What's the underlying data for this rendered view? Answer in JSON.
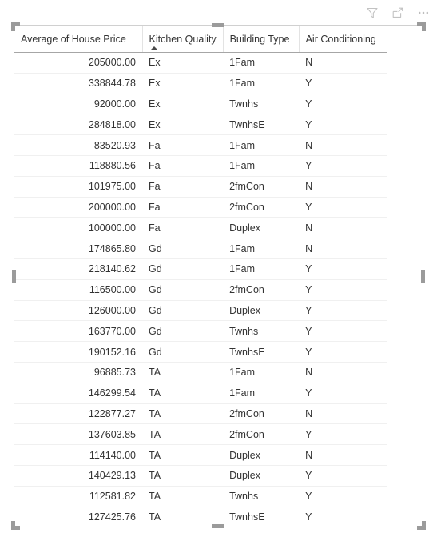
{
  "toolbar": {
    "icons": [
      {
        "name": "filter-icon",
        "label": "Filters"
      },
      {
        "name": "focus-mode-icon",
        "label": "Focus mode"
      },
      {
        "name": "more-options-icon",
        "label": "More options"
      }
    ]
  },
  "table": {
    "sorted_column": "Kitchen Quality",
    "sort_direction": "ascending",
    "columns": [
      {
        "key": "avg_price",
        "label": "Average of House Price",
        "align": "right"
      },
      {
        "key": "kitchen_quality",
        "label": "Kitchen Quality",
        "align": "left"
      },
      {
        "key": "building_type",
        "label": "Building Type",
        "align": "left"
      },
      {
        "key": "air_conditioning",
        "label": "Air Conditioning",
        "align": "left"
      }
    ],
    "rows": [
      {
        "avg_price": "205000.00",
        "kitchen_quality": "Ex",
        "building_type": "1Fam",
        "air_conditioning": "N"
      },
      {
        "avg_price": "338844.78",
        "kitchen_quality": "Ex",
        "building_type": "1Fam",
        "air_conditioning": "Y"
      },
      {
        "avg_price": "92000.00",
        "kitchen_quality": "Ex",
        "building_type": "Twnhs",
        "air_conditioning": "Y"
      },
      {
        "avg_price": "284818.00",
        "kitchen_quality": "Ex",
        "building_type": "TwnhsE",
        "air_conditioning": "Y"
      },
      {
        "avg_price": "83520.93",
        "kitchen_quality": "Fa",
        "building_type": "1Fam",
        "air_conditioning": "N"
      },
      {
        "avg_price": "118880.56",
        "kitchen_quality": "Fa",
        "building_type": "1Fam",
        "air_conditioning": "Y"
      },
      {
        "avg_price": "101975.00",
        "kitchen_quality": "Fa",
        "building_type": "2fmCon",
        "air_conditioning": "N"
      },
      {
        "avg_price": "200000.00",
        "kitchen_quality": "Fa",
        "building_type": "2fmCon",
        "air_conditioning": "Y"
      },
      {
        "avg_price": "100000.00",
        "kitchen_quality": "Fa",
        "building_type": "Duplex",
        "air_conditioning": "N"
      },
      {
        "avg_price": "174865.80",
        "kitchen_quality": "Gd",
        "building_type": "1Fam",
        "air_conditioning": "N"
      },
      {
        "avg_price": "218140.62",
        "kitchen_quality": "Gd",
        "building_type": "1Fam",
        "air_conditioning": "Y"
      },
      {
        "avg_price": "116500.00",
        "kitchen_quality": "Gd",
        "building_type": "2fmCon",
        "air_conditioning": "Y"
      },
      {
        "avg_price": "126000.00",
        "kitchen_quality": "Gd",
        "building_type": "Duplex",
        "air_conditioning": "Y"
      },
      {
        "avg_price": "163770.00",
        "kitchen_quality": "Gd",
        "building_type": "Twnhs",
        "air_conditioning": "Y"
      },
      {
        "avg_price": "190152.16",
        "kitchen_quality": "Gd",
        "building_type": "TwnhsE",
        "air_conditioning": "Y"
      },
      {
        "avg_price": "96885.73",
        "kitchen_quality": "TA",
        "building_type": "1Fam",
        "air_conditioning": "N"
      },
      {
        "avg_price": "146299.54",
        "kitchen_quality": "TA",
        "building_type": "1Fam",
        "air_conditioning": "Y"
      },
      {
        "avg_price": "122877.27",
        "kitchen_quality": "TA",
        "building_type": "2fmCon",
        "air_conditioning": "N"
      },
      {
        "avg_price": "137603.85",
        "kitchen_quality": "TA",
        "building_type": "2fmCon",
        "air_conditioning": "Y"
      },
      {
        "avg_price": "114140.00",
        "kitchen_quality": "TA",
        "building_type": "Duplex",
        "air_conditioning": "N"
      },
      {
        "avg_price": "140429.13",
        "kitchen_quality": "TA",
        "building_type": "Duplex",
        "air_conditioning": "Y"
      },
      {
        "avg_price": "112581.82",
        "kitchen_quality": "TA",
        "building_type": "Twnhs",
        "air_conditioning": "Y"
      },
      {
        "avg_price": "127425.76",
        "kitchen_quality": "TA",
        "building_type": "TwnhsE",
        "air_conditioning": "Y"
      }
    ]
  },
  "colors": {
    "text": "#333333",
    "header_rule": "#a6a6a6",
    "row_rule": "#f0f0f0",
    "grid": "#e3e3e3",
    "frame_border": "#d0d0d0",
    "handle": "#9b9b9b",
    "icon": "#c0c0c0",
    "background": "#ffffff"
  }
}
